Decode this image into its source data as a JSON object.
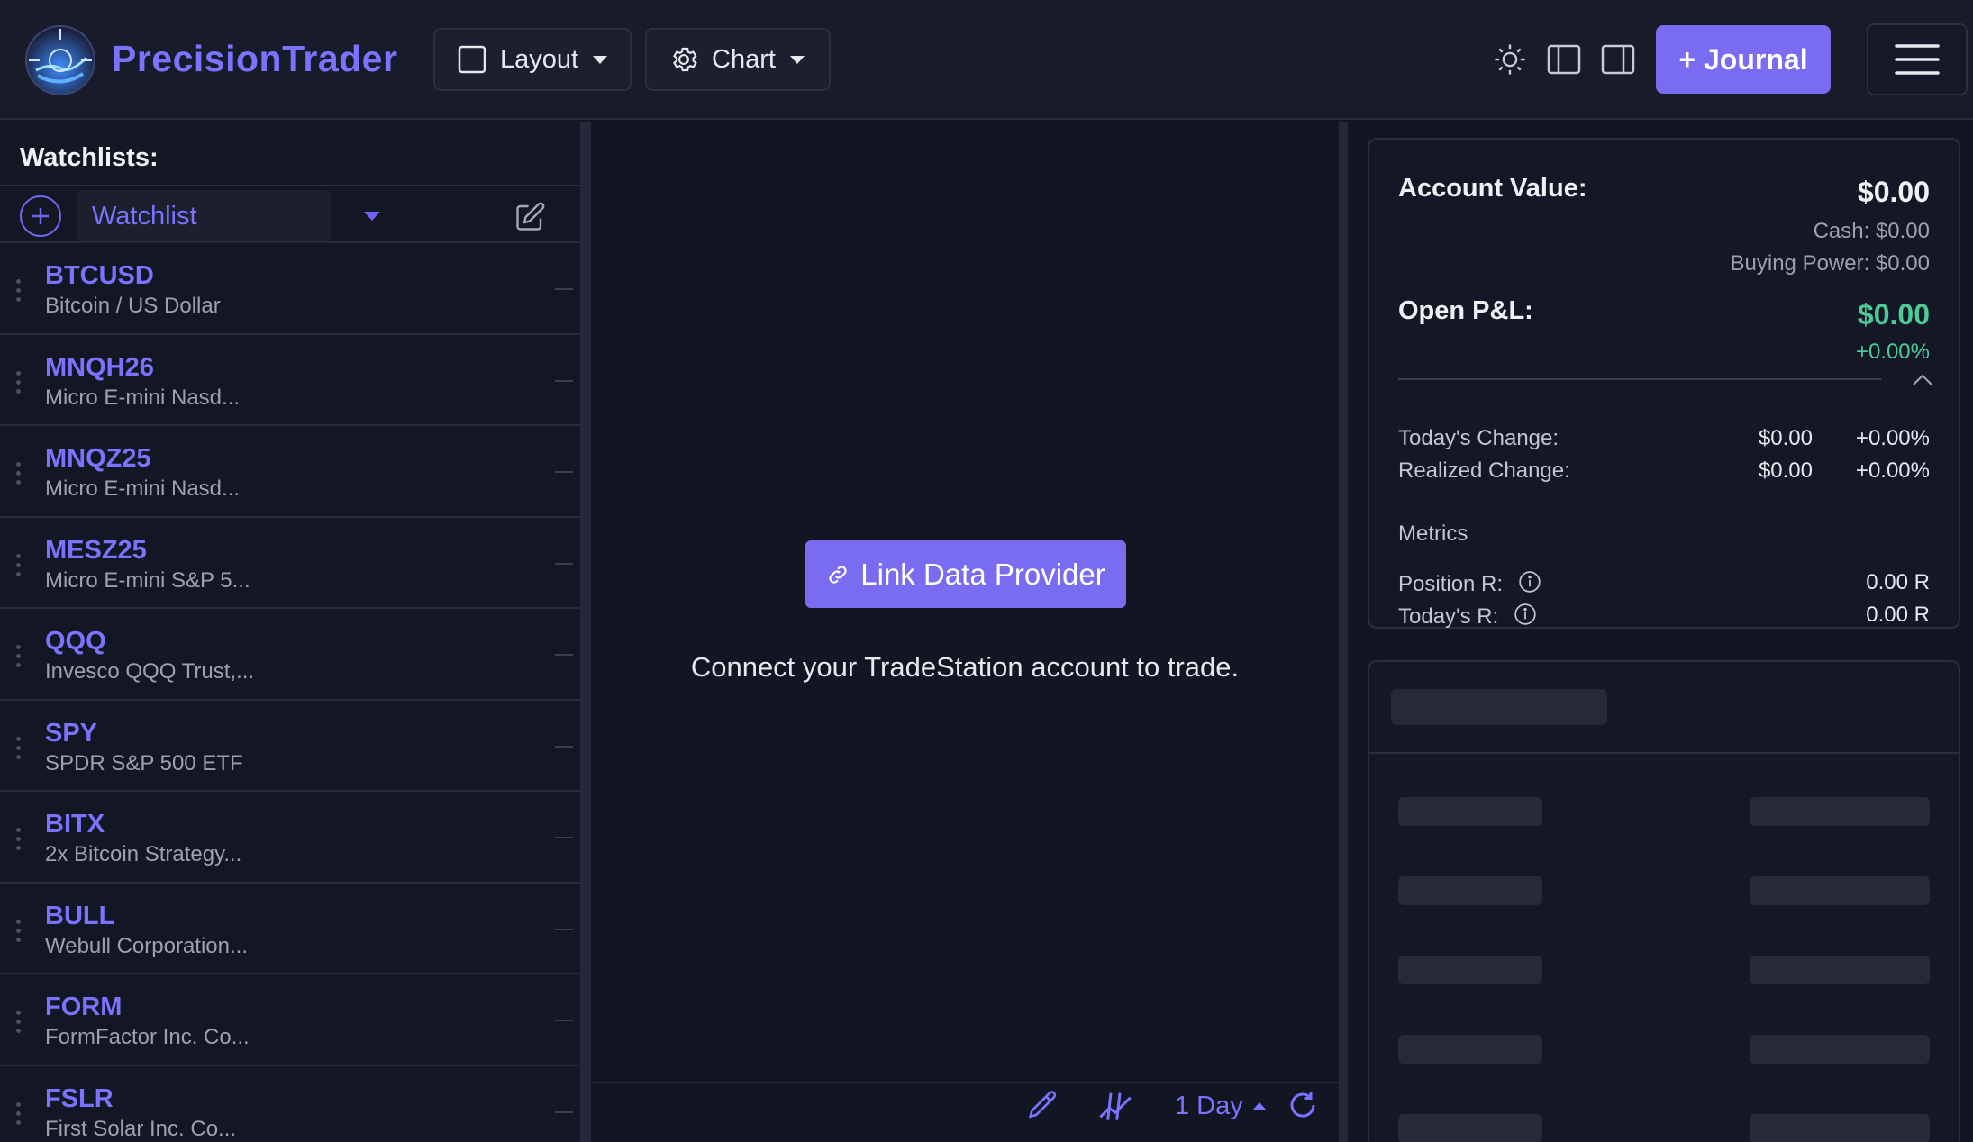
{
  "header": {
    "brand": "PrecisionTrader",
    "layout_label": "Layout",
    "chart_label": "Chart",
    "journal_label": "+ Journal"
  },
  "sidebar": {
    "title": "Watchlists:",
    "selected_watchlist": "Watchlist",
    "items": [
      {
        "symbol": "BTCUSD",
        "description": "Bitcoin / US Dollar"
      },
      {
        "symbol": "MNQH26",
        "description": "Micro E-mini Nasd..."
      },
      {
        "symbol": "MNQZ25",
        "description": "Micro E-mini Nasd..."
      },
      {
        "symbol": "MESZ25",
        "description": "Micro E-mini S&P 5..."
      },
      {
        "symbol": "QQQ",
        "description": "Invesco QQQ Trust,..."
      },
      {
        "symbol": "SPY",
        "description": "SPDR S&P 500 ETF"
      },
      {
        "symbol": "BITX",
        "description": "2x Bitcoin Strategy..."
      },
      {
        "symbol": "BULL",
        "description": "Webull Corporation..."
      },
      {
        "symbol": "FORM",
        "description": "FormFactor Inc. Co..."
      },
      {
        "symbol": "FSLR",
        "description": "First Solar Inc. Co..."
      }
    ]
  },
  "center": {
    "link_button": "Link Data Provider",
    "connect_message": "Connect your TradeStation account to trade.",
    "period": "1 Day"
  },
  "account": {
    "value_label": "Account Value:",
    "value": "$0.00",
    "cash": "Cash: $0.00",
    "buying_power": "Buying Power: $0.00",
    "open_pnl_label": "Open P&L:",
    "open_pnl": "$0.00",
    "open_pnl_pct": "+0.00%",
    "todays_change_label": "Today's Change:",
    "todays_change_value": "$0.00",
    "todays_change_pct": "+0.00%",
    "realized_change_label": "Realized Change:",
    "realized_change_value": "$0.00",
    "realized_change_pct": "+0.00%",
    "metrics_label": "Metrics",
    "position_r_label": "Position R:",
    "position_r": "0.00 R",
    "todays_r_label": "Today's R:",
    "todays_r": "0.00 R"
  },
  "colors": {
    "accent": "#7a6cf0",
    "positive": "#4ecb95",
    "background": "#121522"
  }
}
